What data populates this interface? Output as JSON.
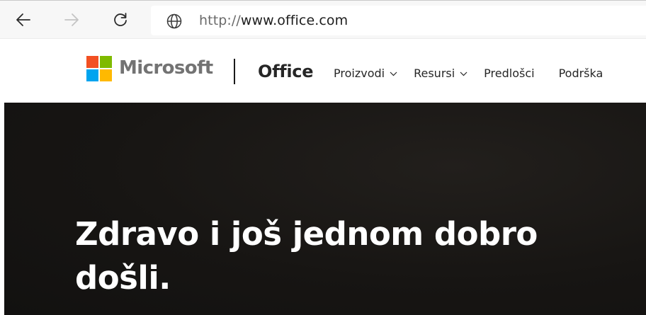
{
  "browser": {
    "back_icon": "back-arrow-icon",
    "forward_icon": "forward-arrow-icon",
    "refresh_icon": "refresh-icon",
    "site_icon": "globe-icon",
    "url_scheme": "http://",
    "url_host": "www.office.com"
  },
  "header": {
    "logo_icon": "microsoft-logo-icon",
    "brand": "Microsoft",
    "product": "Office",
    "nav": [
      {
        "label": "Proizvodi",
        "has_dropdown": true
      },
      {
        "label": "Resursi",
        "has_dropdown": true
      },
      {
        "label": "Predlošci",
        "has_dropdown": false
      },
      {
        "label": "Podrška",
        "has_dropdown": false
      }
    ]
  },
  "hero": {
    "heading": "Zdravo i još jednom dobro došli."
  },
  "colors": {
    "logo_red": "#f25022",
    "logo_green": "#7fba00",
    "logo_blue": "#00a4ef",
    "logo_yellow": "#ffb900",
    "hero_background": "#171513",
    "hero_text": "#ffffff"
  }
}
